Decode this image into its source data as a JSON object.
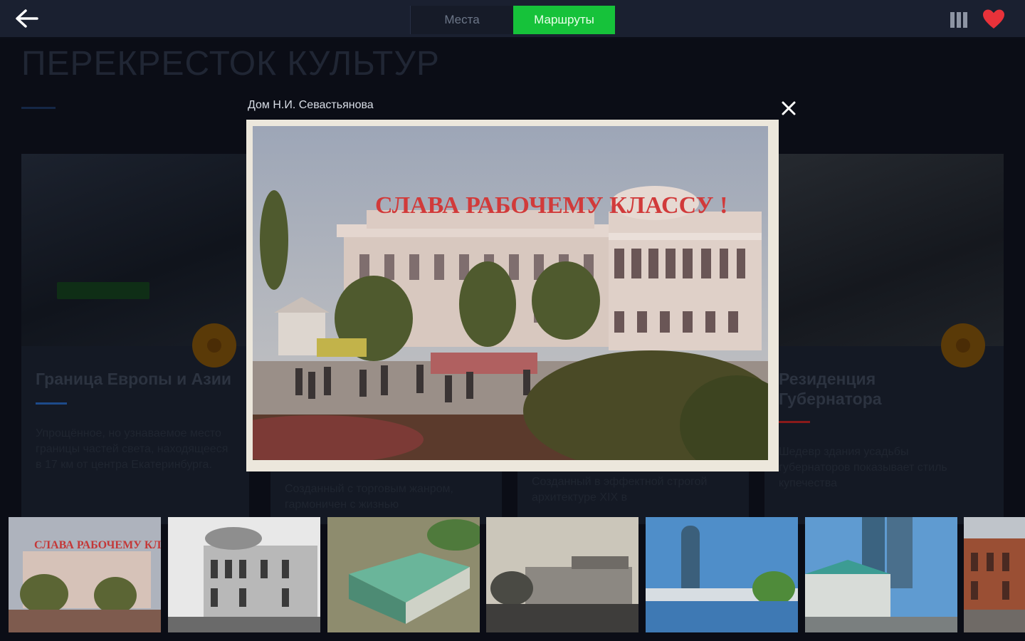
{
  "topbar": {
    "back_icon": "arrow-left-icon",
    "tabs": [
      {
        "label": "Места",
        "active": false
      },
      {
        "label": "Маршруты",
        "active": true
      }
    ],
    "library_icon": "library-icon",
    "favorites_icon": "heart-icon",
    "accent_color": "#16c23a",
    "favorite_color": "#e8323a"
  },
  "background": {
    "page_title": "ПЕРЕКРЕСТОК КУЛЬТУР",
    "cards": [
      {
        "title": "Граница Европы и Азии",
        "text": "Упрощённое, но узнаваемое место границы частей света, находящееся в 17 км от центра Екатеринбурга.",
        "badge": "",
        "underline_color": "#1d4a8a"
      },
      {
        "title": "",
        "text": "Созданный с торговым жанром, гармоничен с жизнью",
        "underline_color": ""
      },
      {
        "title": "",
        "text": "Созданный в эффектной строгой архитектуре XIX в",
        "underline_color": ""
      },
      {
        "title": "Резиденция Губернатора",
        "text": "Шедевр здания усадьбы губернаторов показывает стиль купечества",
        "underline_color": "#8a1a1a"
      }
    ]
  },
  "modal": {
    "title": "Дом Н.И. Севастьянова",
    "close_icon": "close-icon",
    "photo_banner": "СЛАВА РАБОЧЕМУ КЛАССУ !"
  },
  "thumbnails": [
    {
      "name": "thumb-colour-postcard",
      "banner": "СЛАВА РАБОЧЕМУ КЛАССУ"
    },
    {
      "name": "thumb-bw-photo"
    },
    {
      "name": "thumb-aerial-green"
    },
    {
      "name": "thumb-old-postcard"
    },
    {
      "name": "thumb-modern-tower"
    },
    {
      "name": "thumb-modern-street"
    },
    {
      "name": "thumb-red-facade"
    }
  ]
}
